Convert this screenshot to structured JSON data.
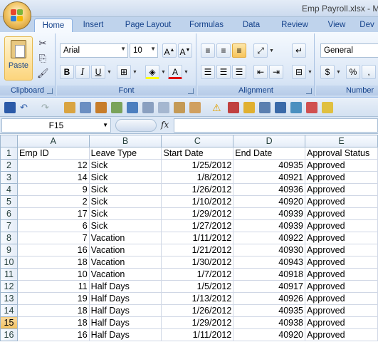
{
  "window": {
    "title": "Emp Payroll.xlsx - M"
  },
  "tabs": [
    "Home",
    "Insert",
    "Page Layout",
    "Formulas",
    "Data",
    "Review",
    "View",
    "Dev"
  ],
  "ribbon": {
    "clipboard": {
      "paste_label": "Paste",
      "group_label": "Clipboard"
    },
    "font": {
      "name": "Arial",
      "size": "10",
      "group_label": "Font"
    },
    "alignment": {
      "group_label": "Alignment"
    },
    "number": {
      "format": "General",
      "group_label": "Number"
    }
  },
  "formula_bar": {
    "name_box": "F15",
    "fx_label": "fx",
    "formula": ""
  },
  "sheet": {
    "columns": [
      "A",
      "B",
      "C",
      "D",
      "E"
    ],
    "rows": [
      {
        "n": "1",
        "a": "Emp ID",
        "b": "Leave Type",
        "c": "Start Date",
        "d": "End Date",
        "e": "Approval Status"
      },
      {
        "n": "2",
        "a": "12",
        "b": "Sick",
        "c": "1/25/2012",
        "d": "40935",
        "e": "Approved"
      },
      {
        "n": "3",
        "a": "14",
        "b": "Sick",
        "c": "1/8/2012",
        "d": "40921",
        "e": "Approved"
      },
      {
        "n": "4",
        "a": "9",
        "b": "Sick",
        "c": "1/26/2012",
        "d": "40936",
        "e": "Approved"
      },
      {
        "n": "5",
        "a": "2",
        "b": "Sick",
        "c": "1/10/2012",
        "d": "40920",
        "e": "Approved"
      },
      {
        "n": "6",
        "a": "17",
        "b": "Sick",
        "c": "1/29/2012",
        "d": "40939",
        "e": "Approved"
      },
      {
        "n": "7",
        "a": "6",
        "b": "Sick",
        "c": "1/27/2012",
        "d": "40939",
        "e": "Approved"
      },
      {
        "n": "8",
        "a": "7",
        "b": "Vacation",
        "c": "1/11/2012",
        "d": "40922",
        "e": "Approved"
      },
      {
        "n": "9",
        "a": "16",
        "b": "Vacation",
        "c": "1/21/2012",
        "d": "40930",
        "e": "Approved"
      },
      {
        "n": "10",
        "a": "18",
        "b": "Vacation",
        "c": "1/30/2012",
        "d": "40943",
        "e": "Approved"
      },
      {
        "n": "11",
        "a": "10",
        "b": "Vacation",
        "c": "1/7/2012",
        "d": "40918",
        "e": "Approved"
      },
      {
        "n": "12",
        "a": "11",
        "b": "Half Days",
        "c": "1/5/2012",
        "d": "40917",
        "e": "Approved"
      },
      {
        "n": "13",
        "a": "19",
        "b": "Half Days",
        "c": "1/13/2012",
        "d": "40926",
        "e": "Approved"
      },
      {
        "n": "14",
        "a": "18",
        "b": "Half Days",
        "c": "1/26/2012",
        "d": "40935",
        "e": "Approved"
      },
      {
        "n": "15",
        "a": "18",
        "b": "Half Days",
        "c": "1/29/2012",
        "d": "40938",
        "e": "Approved"
      },
      {
        "n": "16",
        "a": "16",
        "b": "Half Days",
        "c": "1/11/2012",
        "d": "40920",
        "e": "Approved"
      }
    ],
    "selected_row": "15"
  }
}
